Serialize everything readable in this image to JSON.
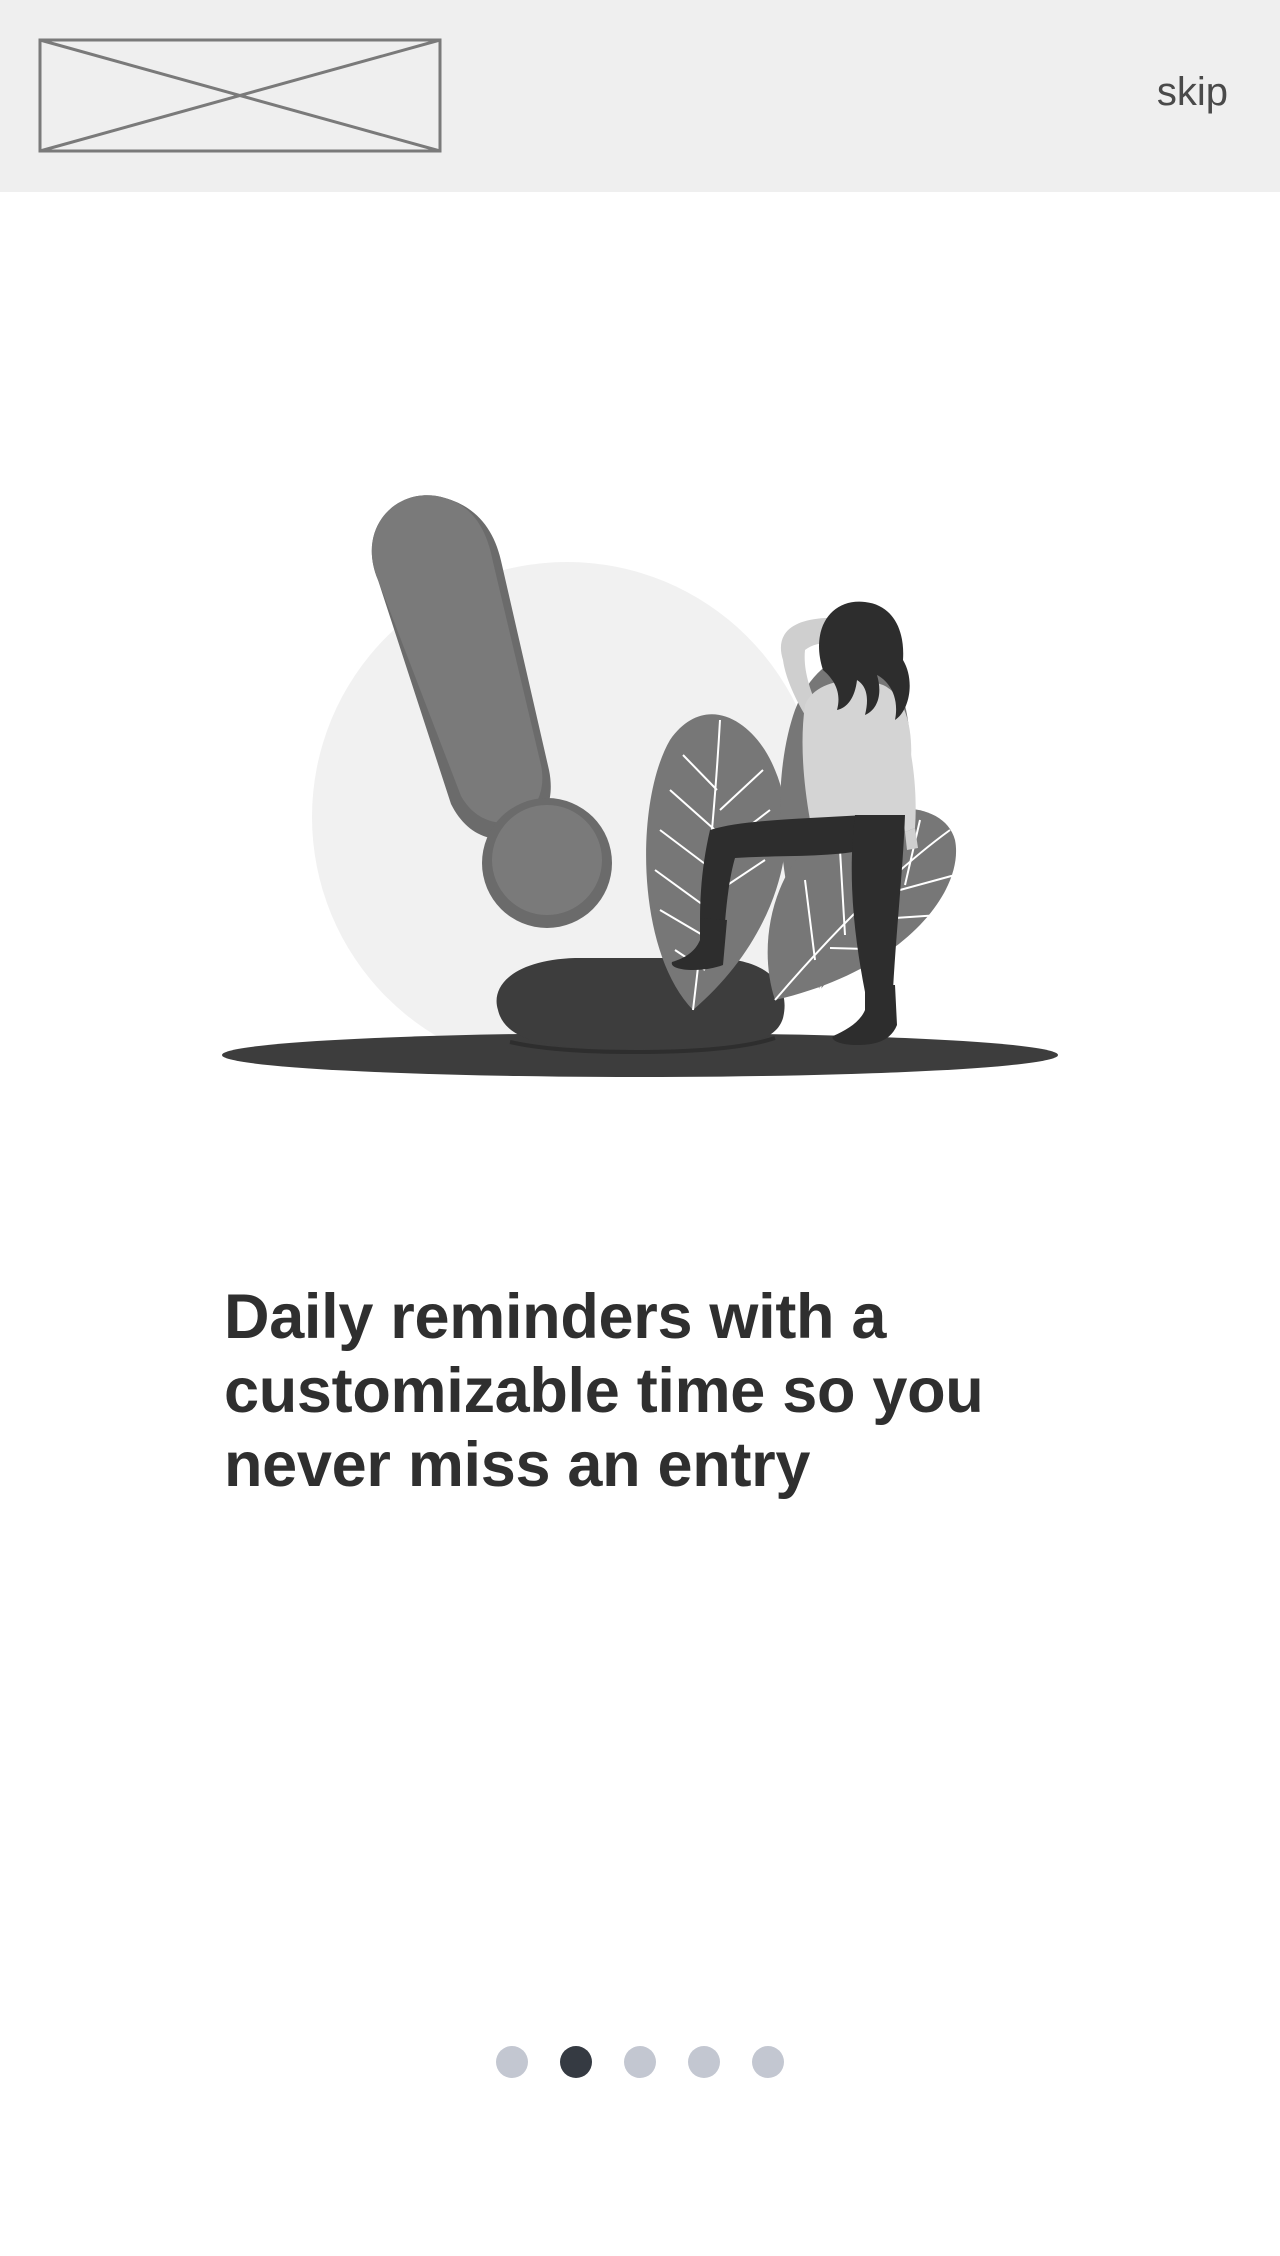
{
  "header": {
    "logo_label": "logo placeholder",
    "skip_label": "skip"
  },
  "main": {
    "illustration_label": "woman leaning on cushion beside exclamation mark",
    "headline": "Daily reminders with a customizable time so you never miss an entry"
  },
  "pager": {
    "count": 5,
    "active_index": 1,
    "active_color": "#353a42",
    "inactive_color": "#c3c7d1"
  },
  "colors": {
    "header_bg": "#efefef",
    "text": "#2f2f2f",
    "illustration_dark": "#3d3d3d",
    "illustration_mid": "#7a7a7a",
    "illustration_light": "#f1f1f1"
  }
}
